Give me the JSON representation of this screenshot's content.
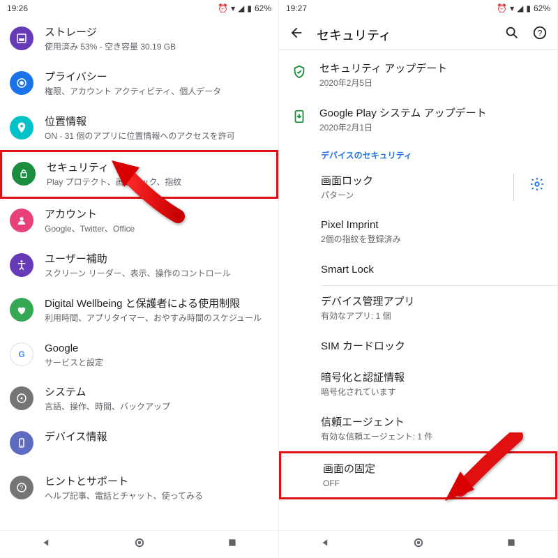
{
  "left": {
    "status": {
      "time": "19:26",
      "battery": "62%"
    },
    "items": [
      {
        "icon": "storage-icon",
        "color": "#673ab7",
        "title": "ストレージ",
        "sub": "使用済み 53% - 空き容量 30.19 GB"
      },
      {
        "icon": "privacy-icon",
        "color": "#1a73e8",
        "title": "プライバシー",
        "sub": "権限、アカウント アクティビティ、個人データ"
      },
      {
        "icon": "location-icon",
        "color": "#00c2c7",
        "title": "位置情報",
        "sub": "ON - 31 個のアプリに位置情報へのアクセスを許可"
      },
      {
        "icon": "security-icon",
        "color": "#1a8e3e",
        "title": "セキュリティ",
        "sub": "Play プロテクト、画面ロック、指紋",
        "highlight": true
      },
      {
        "icon": "account-icon",
        "color": "#e8417a",
        "title": "アカウント",
        "sub": "Google、Twitter、Office"
      },
      {
        "icon": "accessibility-icon",
        "color": "#673ab7",
        "title": "ユーザー補助",
        "sub": "スクリーン リーダー、表示、操作のコントロール"
      },
      {
        "icon": "wellbeing-icon",
        "color": "#34a853",
        "title": "Digital Wellbeing と保護者による使用制限",
        "sub": "利用時間、アプリタイマー、おやすみ時間のスケジュール"
      },
      {
        "icon": "google-icon",
        "color": "#ffffff",
        "title": "Google",
        "sub": "サービスと設定"
      },
      {
        "icon": "system-icon",
        "color": "#757575",
        "title": "システム",
        "sub": "言語、操作、時間、バックアップ"
      },
      {
        "icon": "device-icon",
        "color": "#5e6bc0",
        "title": "デバイス情報",
        "sub": "　"
      },
      {
        "icon": "support-icon",
        "color": "#757575",
        "title": "ヒントとサポート",
        "sub": "ヘルプ記事、電話とチャット、使ってみる"
      }
    ]
  },
  "right": {
    "status": {
      "time": "19:27",
      "battery": "62%"
    },
    "header": {
      "title": "セキュリティ"
    },
    "updates": [
      {
        "icon": "shield-icon",
        "title": "セキュリティ アップデート",
        "sub": "2020年2月5日"
      },
      {
        "icon": "system-update-icon",
        "title": "Google Play システム アップデート",
        "sub": "2020年2月1日"
      }
    ],
    "section": "デバイスのセキュリティ",
    "rows": [
      {
        "title": "画面ロック",
        "sub": "パターン",
        "gear": true,
        "sep": true
      },
      {
        "title": "Pixel Imprint",
        "sub": "2個の指紋を登録済み"
      },
      {
        "title": "Smart Lock",
        "sub": ""
      },
      {
        "title": "デバイス管理アプリ",
        "sub": "有効なアプリ: 1 個",
        "divTop": true
      },
      {
        "title": "SIM カードロック",
        "sub": ""
      },
      {
        "title": "暗号化と認証情報",
        "sub": "暗号化されています"
      },
      {
        "title": "信頼エージェント",
        "sub": "有効な信頼エージェント: 1 件"
      },
      {
        "title": "画面の固定",
        "sub": "OFF",
        "highlight": true
      }
    ]
  }
}
